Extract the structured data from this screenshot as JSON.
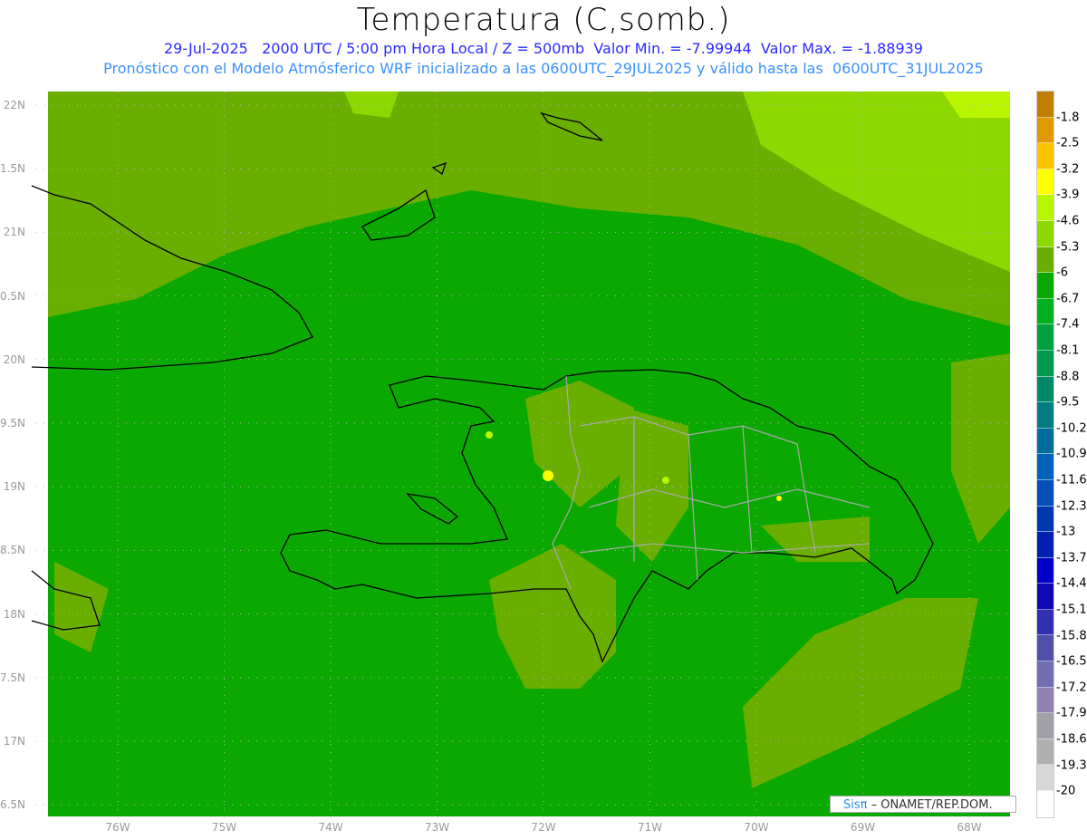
{
  "header": {
    "title": "Temperatura (C,somb.)",
    "info_line": "29-Jul-2025   2000 UTC / 5:00 pm Hora Local / Z = 500mb  Valor Min. = -7.99944  Valor Max. = -1.88939",
    "model_line": "Pronóstico con el Modelo Atmósferico WRF inicializado a las 0600UTC_29JUL2025 y válido hasta las  0600UTC_31JUL2025"
  },
  "axes": {
    "lat_labels": [
      "22N",
      "1.5N",
      "21N",
      "0.5N",
      "20N",
      "9.5N",
      "19N",
      "8.5N",
      "18N",
      "7.5N",
      "17N",
      "6.5N"
    ],
    "lon_labels": [
      "76W",
      "75W",
      "74W",
      "73W",
      "72W",
      "71W",
      "70W",
      "69W",
      "68W"
    ]
  },
  "colorbar": {
    "labels": [
      "-1.8",
      "-2.5",
      "-3.2",
      "-3.9",
      "-4.6",
      "-5.3",
      "-6",
      "-6.7",
      "-7.4",
      "-8.1",
      "-8.8",
      "-9.5",
      "-10.2",
      "-10.9",
      "-11.6",
      "-12.3",
      "-13",
      "-13.7",
      "-14.4",
      "-15.1",
      "-15.8",
      "-16.5",
      "-17.2",
      "-17.9",
      "-18.6",
      "-19.3",
      "-20"
    ],
    "colors": [
      "#c07f00",
      "#e09a00",
      "#ffc400",
      "#ffff00",
      "#b8f500",
      "#8cd800",
      "#6aae00",
      "#0aa800",
      "#00b020",
      "#00a040",
      "#009850",
      "#008868",
      "#007c80",
      "#006c9c",
      "#0062b8",
      "#0050b8",
      "#0038b0",
      "#0020b0",
      "#0000c8",
      "#1008b0",
      "#3030b0",
      "#5050a8",
      "#7070b0",
      "#9080b0",
      "#a0a0a8",
      "#b0b0b0",
      "#d8d8d8",
      "#ffffff"
    ]
  },
  "credit": {
    "brand": "Sisπ",
    "text": " –  ONAMET/REP.DOM."
  }
}
